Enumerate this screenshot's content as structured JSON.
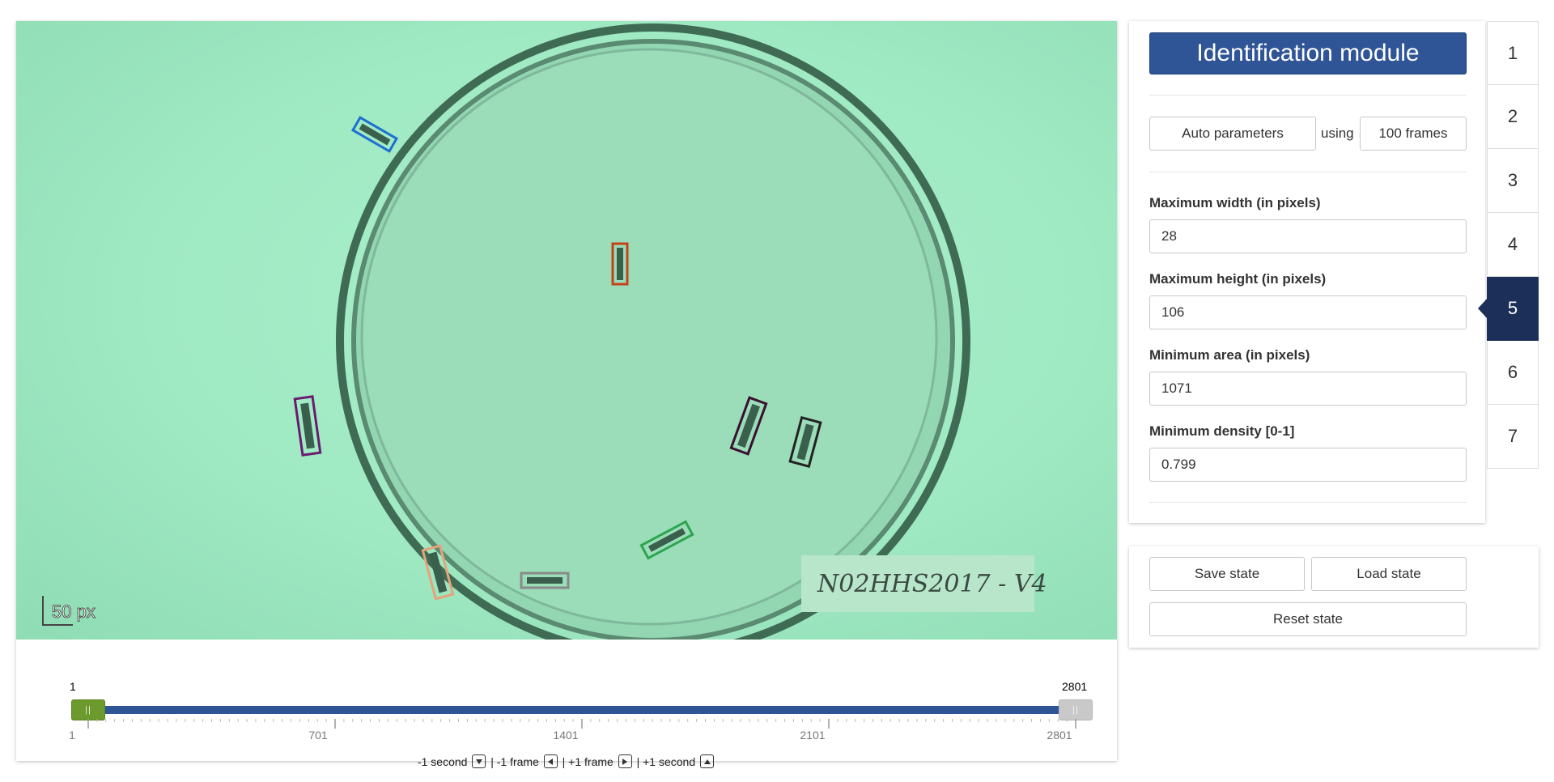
{
  "video": {
    "scale_bar_label": "50 px",
    "dish_label": "N02HHS2017 - V4"
  },
  "timeline": {
    "start_value": "1",
    "end_value": "2801",
    "min": 1,
    "max": 2801,
    "tick_labels": [
      "1",
      "701",
      "1401",
      "2101",
      "2801"
    ],
    "nav_hints": {
      "minus_second": "-1 second",
      "minus_frame": "| -1 frame",
      "plus_frame": "| +1 frame",
      "plus_second": "| +1 second"
    }
  },
  "identification": {
    "title": "Identification module",
    "auto_button": "Auto parameters",
    "using_label": "using",
    "frames_button": "100 frames",
    "fields": [
      {
        "label": "Maximum width (in pixels)",
        "value": "28"
      },
      {
        "label": "Maximum height (in pixels)",
        "value": "106"
      },
      {
        "label": "Minimum area (in pixels)",
        "value": "1071"
      },
      {
        "label": "Minimum density [0-1]",
        "value": "0.799"
      }
    ]
  },
  "steps": {
    "items": [
      "1",
      "2",
      "3",
      "4",
      "5",
      "6",
      "7"
    ],
    "active": "5"
  },
  "state": {
    "save_label": "Save state",
    "load_label": "Load state",
    "reset_label": "Reset state"
  },
  "colors": {
    "primary": "#2f5597",
    "active_step": "#1b2f58",
    "start_handle": "#6c9a2c",
    "detections": [
      "#1e6fd1",
      "#c4421a",
      "#6a1b6f",
      "#3a1030",
      "#222222",
      "#2da44e",
      "#e8a27a",
      "#8a8a8a"
    ]
  }
}
